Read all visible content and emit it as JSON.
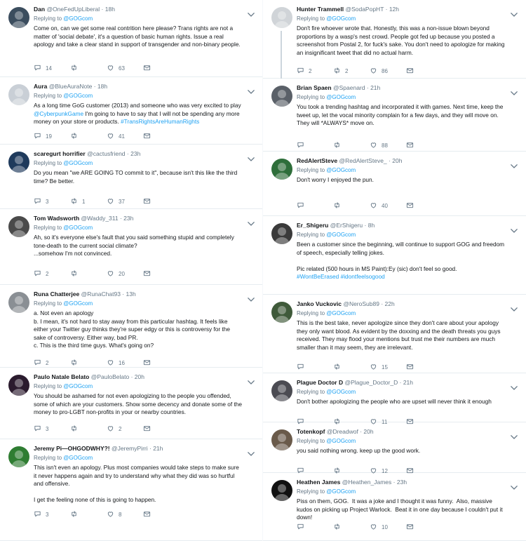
{
  "left": [
    {
      "avatar_color": "#3b4d5e",
      "name": "Dan",
      "handle": "@OneFedUpLiberal",
      "time": "18h",
      "reply_to": "@GOGcom",
      "body": "Come on, can we get some real contrition here please? Trans rights are not a matter of 'social debate', it's a question of basic human rights. Issue a real apology and take a clear stand in support of transgender and non-binary people.",
      "replies": "14",
      "retweets": "",
      "likes": "63"
    },
    {
      "avatar_color": "#c9cfd6",
      "name": "Aura",
      "handle": "@BlueAuraNote",
      "time": "18h",
      "reply_to": "@GOGcom",
      "body": "As a long time GoG customer (2013) and someone who was very excited to play @CyberpunkGame I'm going to have to say that I will not be spending any more money on your store or products. #TransRightsAreHumanRights",
      "replies": "19",
      "retweets": "",
      "likes": "41"
    },
    {
      "avatar_color": "#1f3a5c",
      "name": "scaregurt horrifier",
      "handle": "@cactusfriend",
      "time": "23h",
      "reply_to": "@GOGcom",
      "body": "Do you mean \"we ARE GOING TO commit to it\", because isn't this like the third time? Be better.",
      "replies": "3",
      "retweets": "1",
      "likes": "37"
    },
    {
      "avatar_color": "#4a4a4a",
      "name": "Tom Wadsworth",
      "handle": "@Waddy_311",
      "time": "23h",
      "reply_to": "@GOGcom",
      "body": "Ah, so it's everyone else's fault that you said something stupid and completely tone-death to the current social climate?\n...somehow I'm not convinced.",
      "replies": "2",
      "retweets": "",
      "likes": "20"
    },
    {
      "avatar_color": "#8a8f94",
      "name": "Runa Chatterjee",
      "handle": "@RunaChat93",
      "time": "13h",
      "reply_to": "@GOGcom",
      "body": "a. Not even an apology\nb. I mean, it's not hard to stay away from this particular hashtag. It feels like either your Twitter guy thinks they're super edgy or this is controversy for the sake of controversy. Either way, bad PR.\nc. This is the third time guys. What's going on?",
      "replies": "2",
      "retweets": "",
      "likes": "16"
    },
    {
      "avatar_color": "#2b1b2e",
      "name": "Paulo Natale Belato",
      "handle": "@PauloBelato",
      "time": "20h",
      "reply_to": "@GOGcom",
      "body": "You should be ashamed for not even apologizing to the people you offended, some of which are your customers. Show some decency and donate some of the money to pro-LGBT non-profits in your or nearby countries.",
      "replies": "3",
      "retweets": "",
      "likes": "2"
    },
    {
      "avatar_color": "#2f7d32",
      "name": "Jeremy Pi—OHGODWHY?!",
      "handle": "@JeremyPirri",
      "time": "21h",
      "reply_to": "@GOGcom",
      "body": "This isn't even an apology. Plus most companies would take steps to make sure it never happens again and try to understand why what they did was so hurtful and offensive.\n\nI get the feeling none of this is going to happen.",
      "replies": "3",
      "retweets": "",
      "likes": "8"
    }
  ],
  "right": [
    {
      "avatar_color": "#d0d4d8",
      "name": "Hunter Trammell",
      "handle": "@SodaPopHT",
      "time": "12h",
      "reply_to": "@GOGcom",
      "body": "Don't fire whoever wrote that. Honestly, this was a non-issue blown beyond proportions by a wasp's nest crowd. People got fed up because you posted a screenshot from Postal 2, for fuck's sake. You don't need to apologize for making an insignificant tweet that did no actual harm.",
      "replies": "2",
      "retweets": "2",
      "likes": "86"
    },
    {
      "avatar_color": "#5a6068",
      "name": "Brian Spaen",
      "handle": "@Spaenard",
      "time": "21h",
      "reply_to": "@GOGcom",
      "body": "You took a trending hashtag and incorporated it with games. Next time, keep the tweet up, let the vocal minority complain for a few days, and they will move on. They will *ALWAYS* move on.",
      "replies": "",
      "retweets": "",
      "likes": "88"
    },
    {
      "avatar_color": "#2e6e3a",
      "name": "RedAlertSteve",
      "handle": "@RedAlertSteve_",
      "time": "20h",
      "reply_to": "@GOGcom",
      "body": "Don't worry I enjoyed the pun.",
      "replies": "",
      "retweets": "",
      "likes": "40"
    },
    {
      "avatar_color": "#3a3a3a",
      "name": "Er_Shigeru",
      "handle": "@ErShigeru",
      "time": "8h",
      "reply_to": "@GOGcom",
      "body": "Been a customer since the beginning, will continue to support GOG and freedom of speech, especially telling jokes.\n\nPic related (500 hours in MS Paint):Ey (sic) don't feel so good.\n#WontBeErased #idontfeelsogood",
      "replies": "",
      "retweets": "",
      "likes": ""
    },
    {
      "avatar_color": "#3f5a3a",
      "name": "Janko Vuckovic",
      "handle": "@NeroSub89",
      "time": "22h",
      "reply_to": "@GOGcom",
      "body": "This is the best take, never apologize since they don't care about your apology they only want blood. As evident by the doxxing and the death threats you guys received. They may flood your mentions but trust me their numbers are much smaller than it may seem, they are irrelevant.",
      "replies": "",
      "retweets": "",
      "likes": "15"
    },
    {
      "avatar_color": "#4b4b52",
      "name": "Plague Doctor D",
      "handle": "@Plague_Doctor_D",
      "time": "21h",
      "reply_to": "@GOGcom",
      "body": "Don't bother apologizing the people who are upset will never think it enough",
      "replies": "",
      "retweets": "",
      "likes": "11"
    },
    {
      "avatar_color": "#6a5a4a",
      "name": "Totenkopf",
      "handle": "@Dreadwof",
      "time": "20h",
      "reply_to": "@GOGcom",
      "body": "you said nothing wrong. keep up the good work.",
      "replies": "",
      "retweets": "",
      "likes": "12"
    },
    {
      "avatar_color": "#111111",
      "name": "Heathen James",
      "handle": "@Heathen_James",
      "time": "23h",
      "reply_to": "@GOGcom",
      "body": "Piss on them, GOG.  It was a joke and I thought it was funny.  Also, massive kudos on picking up Project Warlock.  Beat it in one day because I couldn't put it down!",
      "replies": "",
      "retweets": "",
      "likes": "10"
    }
  ],
  "ui": {
    "replying_prefix": "Replying to",
    "sep": "·",
    "accent": "#1da1f2",
    "muted": "#657786"
  }
}
